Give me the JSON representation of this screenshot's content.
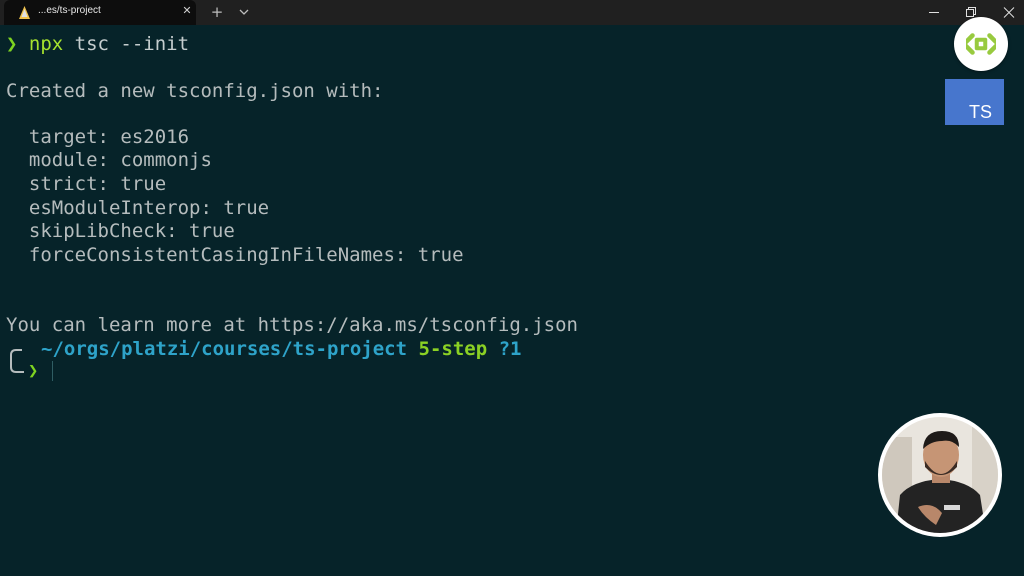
{
  "window": {
    "tab_title": "...es/ts-project",
    "tab_icon": "terminal-app-icon",
    "close_tab_symbol": "✕",
    "new_tab_symbol": "+"
  },
  "terminal": {
    "prompt_symbol": "❯",
    "command_name": "npx",
    "command_args": " tsc --init",
    "created_message": "Created a new tsconfig.json with:",
    "options": [
      "  target: es2016",
      "  module: commonjs",
      "  strict: true",
      "  esModuleInterop: true",
      "  skipLibCheck: true",
      "  forceConsistentCasingInFileNames: true"
    ],
    "learn_more": "You can learn more at https://aka.ms/tsconfig.json",
    "prompt": {
      "path": "~/orgs/platzi/courses/ts-project",
      "branch": "5-step",
      "git_status": "?1",
      "arrow": "❯"
    }
  },
  "overlays": {
    "ts_badge_text": "TS",
    "logo": "platzi-logo-icon"
  },
  "colors": {
    "background": "#062329",
    "prompt_green": "#7ed321",
    "path_blue": "#2ea3c9",
    "ts_blue": "#4776cd"
  }
}
